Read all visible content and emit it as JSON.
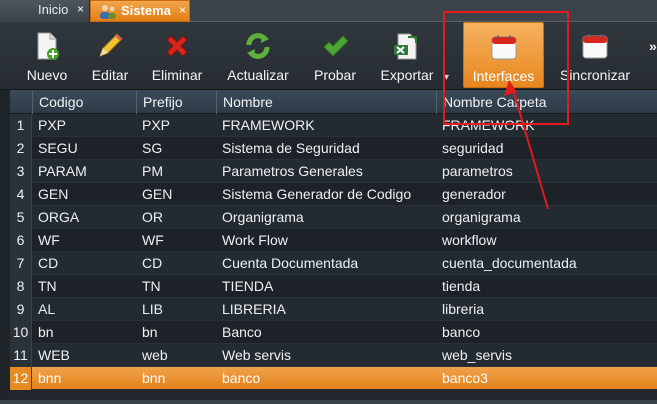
{
  "tabs": [
    {
      "label": "Inicio",
      "close": "×"
    },
    {
      "label": "Sistema",
      "close": "×"
    }
  ],
  "toolbar": {
    "buttons": [
      {
        "label": "Nuevo",
        "icon": "new-document-icon"
      },
      {
        "label": "Editar",
        "icon": "pencil-icon"
      },
      {
        "label": "Eliminar",
        "icon": "red-x-icon"
      },
      {
        "label": "Actualizar",
        "icon": "refresh-icon"
      },
      {
        "label": "Probar",
        "icon": "checkmark-icon"
      },
      {
        "label": "Exportar",
        "icon": "export-icon"
      },
      {
        "label": "Interfaces",
        "icon": "calendar-icon"
      },
      {
        "label": "Sincronizar",
        "icon": "calendar-icon"
      }
    ],
    "dropdown_glyph": "▾",
    "scroll_glyph": "»"
  },
  "grid": {
    "columns": [
      "Codigo",
      "Prefijo",
      "Nombre",
      "Nombre Carpeta"
    ],
    "rows": [
      {
        "n": "1",
        "codigo": "PXP",
        "prefijo": "PXP",
        "nombre": "FRAMEWORK",
        "carpeta": "FRAMEWORK"
      },
      {
        "n": "2",
        "codigo": "SEGU",
        "prefijo": "SG",
        "nombre": "Sistema de Seguridad",
        "carpeta": "seguridad"
      },
      {
        "n": "3",
        "codigo": "PARAM",
        "prefijo": "PM",
        "nombre": "Parametros Generales",
        "carpeta": "parametros"
      },
      {
        "n": "4",
        "codigo": "GEN",
        "prefijo": "GEN",
        "nombre": "Sistema Generador de Codigo",
        "carpeta": "generador"
      },
      {
        "n": "5",
        "codigo": "ORGA",
        "prefijo": "OR",
        "nombre": "Organigrama",
        "carpeta": "organigrama"
      },
      {
        "n": "6",
        "codigo": "WF",
        "prefijo": "WF",
        "nombre": "Work Flow",
        "carpeta": "workflow"
      },
      {
        "n": "7",
        "codigo": "CD",
        "prefijo": "CD",
        "nombre": "Cuenta Documentada",
        "carpeta": "cuenta_documentada"
      },
      {
        "n": "8",
        "codigo": "TN",
        "prefijo": "TN",
        "nombre": "TIENDA",
        "carpeta": "tienda"
      },
      {
        "n": "9",
        "codigo": "AL",
        "prefijo": "LIB",
        "nombre": "LIBRERIA",
        "carpeta": "libreria"
      },
      {
        "n": "10",
        "codigo": "bn",
        "prefijo": "bn",
        "nombre": "Banco",
        "carpeta": "banco"
      },
      {
        "n": "11",
        "codigo": "WEB",
        "prefijo": "web",
        "nombre": "Web servis",
        "carpeta": "web_servis"
      },
      {
        "n": "12",
        "codigo": "bnn",
        "prefijo": "bnn",
        "nombre": "banco",
        "carpeta": "banco3"
      }
    ],
    "selected_row": 11
  },
  "colors": {
    "accent": "#e68a24",
    "annotation": "#e21b1b"
  }
}
